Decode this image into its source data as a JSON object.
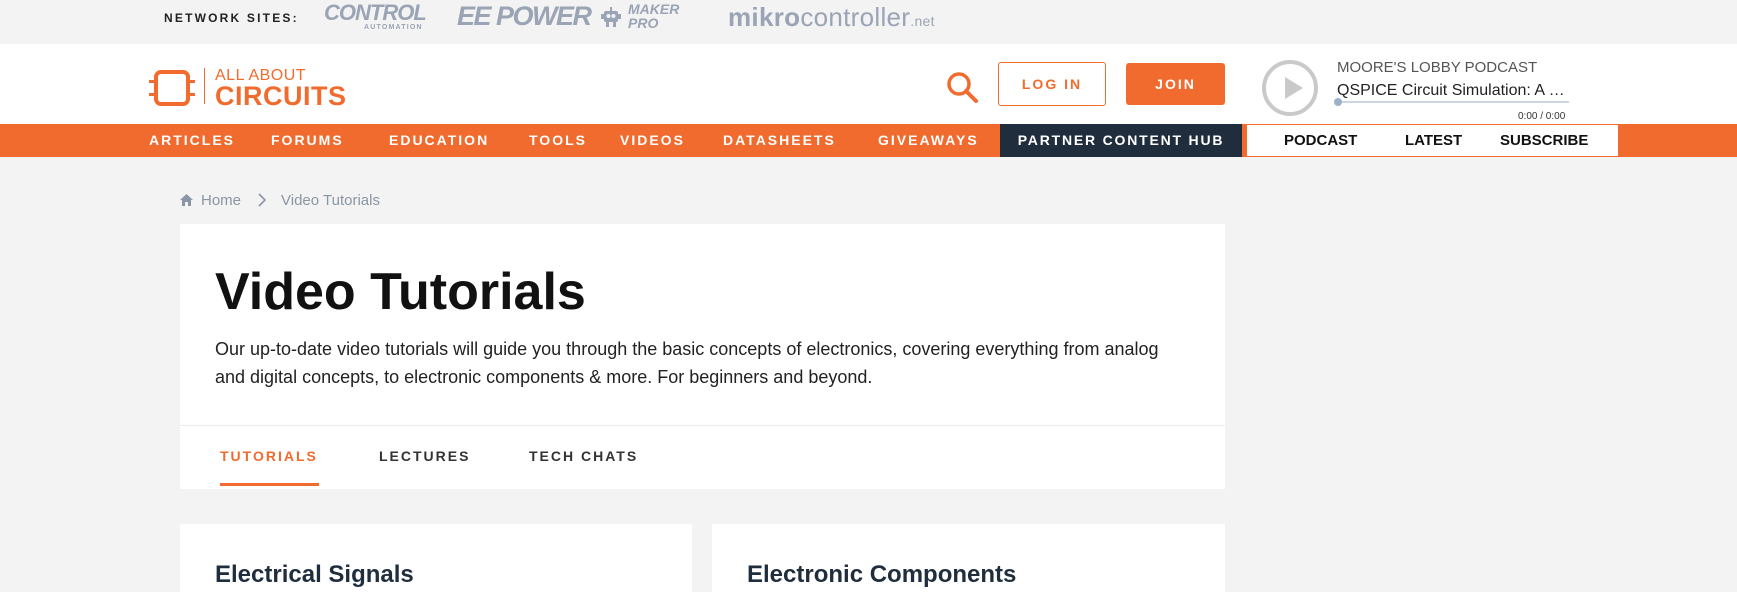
{
  "network_bar": {
    "label": "NETWORK SITES:",
    "sites": {
      "control_automation": {
        "main": "CONTROL",
        "sub": "AUTOMATION"
      },
      "ee_power": "EE POWER",
      "maker_pro": {
        "line1": "MAKER",
        "line2": "PRO"
      },
      "mikrocontroller": {
        "bold": "mikro",
        "regular": "controller",
        "suffix": ".net"
      }
    }
  },
  "header": {
    "logo": {
      "top": "ALL ABOUT",
      "bottom": "CIRCUITS"
    },
    "login_label": "LOG IN",
    "join_label": "JOIN",
    "podcast": {
      "name": "MOORE'S LOBBY PODCAST",
      "episode_title": "QSPICE Circuit Simulation: A Spic...",
      "time": "0:00 / 0:00",
      "progress": 0
    }
  },
  "main_nav": {
    "items": [
      "ARTICLES",
      "FORUMS",
      "EDUCATION",
      "TOOLS",
      "VIDEOS",
      "DATASHEETS",
      "GIVEAWAYS"
    ],
    "partner_label": "PARTNER CONTENT HUB",
    "podcast_links": [
      "PODCAST",
      "LATEST",
      "SUBSCRIBE"
    ]
  },
  "breadcrumb": {
    "home": "Home",
    "current": "Video Tutorials"
  },
  "intro": {
    "title": "Video Tutorials",
    "description": "Our up-to-date video tutorials will guide you through the basic concepts of electronics, covering everything from analog and digital concepts, to electronic components & more. For beginners and beyond.",
    "tabs": [
      "TUTORIALS",
      "LECTURES",
      "TECH CHATS"
    ],
    "active_tab": "TUTORIALS"
  },
  "categories": [
    "Electrical Signals",
    "Electronic Components"
  ],
  "colors": {
    "accent": "#f26b2e",
    "dark_navy": "#1f2d3d",
    "background": "#f3f3f3",
    "muted_logo": "#9aa4b4"
  }
}
